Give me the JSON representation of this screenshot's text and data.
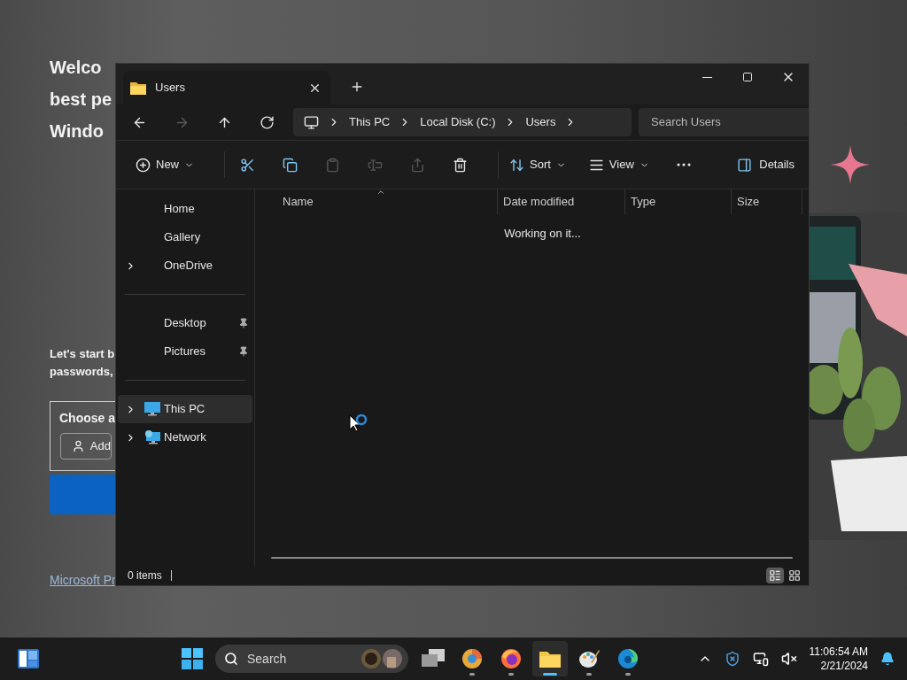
{
  "background_page": {
    "heading_lines": [
      "Welco",
      "best pe",
      "Windo"
    ],
    "intro_lines": [
      "Let's start b",
      "passwords,"
    ],
    "card_title": "Choose a",
    "add_button": "Add",
    "link": "Microsoft Pr"
  },
  "explorer": {
    "tabs": [
      {
        "label": "Users",
        "selected": true
      }
    ],
    "nav": [
      {
        "kind": "back",
        "disabled": false
      },
      {
        "kind": "forward",
        "disabled": true
      },
      {
        "kind": "up",
        "disabled": false
      },
      {
        "kind": "refresh",
        "disabled": false
      }
    ],
    "breadcrumb": [
      "This PC",
      "Local Disk (C:)",
      "Users"
    ],
    "search": {
      "placeholder": "Search Users"
    },
    "toolbar": [
      {
        "kind": "new",
        "label": "New",
        "disabled": false
      },
      {
        "kind": "cut",
        "disabled": false
      },
      {
        "kind": "copy",
        "disabled": false
      },
      {
        "kind": "paste",
        "disabled": true
      },
      {
        "kind": "rename",
        "disabled": true
      },
      {
        "kind": "share",
        "disabled": true
      },
      {
        "kind": "delete",
        "disabled": false
      },
      {
        "kind": "sort",
        "label": "Sort",
        "disabled": false
      },
      {
        "kind": "view",
        "label": "View",
        "disabled": false
      },
      {
        "kind": "more",
        "disabled": false
      }
    ],
    "details_button": "Details",
    "sidebar": [
      [
        {
          "label": "Home",
          "kind": "plain",
          "expandable": false,
          "pinned": false,
          "selected": false
        },
        {
          "label": "Gallery",
          "kind": "plain",
          "expandable": false,
          "pinned": false,
          "selected": false
        },
        {
          "label": "OneDrive",
          "kind": "plain",
          "expandable": true,
          "pinned": false,
          "selected": false
        }
      ],
      [
        {
          "label": "Desktop",
          "kind": "plain",
          "expandable": false,
          "pinned": true,
          "selected": false
        },
        {
          "label": "Pictures",
          "kind": "plain",
          "expandable": false,
          "pinned": true,
          "selected": false
        }
      ],
      [
        {
          "label": "This PC",
          "kind": "pc",
          "expandable": true,
          "pinned": false,
          "selected": true
        },
        {
          "label": "Network",
          "kind": "network",
          "expandable": true,
          "pinned": false,
          "selected": false
        }
      ]
    ],
    "columns": [
      {
        "label": "Name",
        "sorted": true
      },
      {
        "label": "Date modified",
        "sorted": false
      },
      {
        "label": "Type",
        "sorted": false
      },
      {
        "label": "Size",
        "sorted": false
      }
    ],
    "message": "Working on it...",
    "status": "0 items",
    "view_modes": [
      {
        "kind": "details",
        "selected": true
      },
      {
        "kind": "tiles",
        "selected": false
      }
    ]
  },
  "taskbar": {
    "search_placeholder": "Search",
    "apps": [
      {
        "kind": "taskview",
        "running": false,
        "active": false
      },
      {
        "kind": "canary",
        "running": true,
        "active": false
      },
      {
        "kind": "firefox",
        "running": true,
        "active": false
      },
      {
        "kind": "explorer",
        "running": true,
        "active": true
      },
      {
        "kind": "paint",
        "running": true,
        "active": false
      },
      {
        "kind": "edge",
        "running": true,
        "active": false
      }
    ],
    "clock": {
      "time": "11:06:54 AM",
      "date": "2/21/2024"
    }
  }
}
